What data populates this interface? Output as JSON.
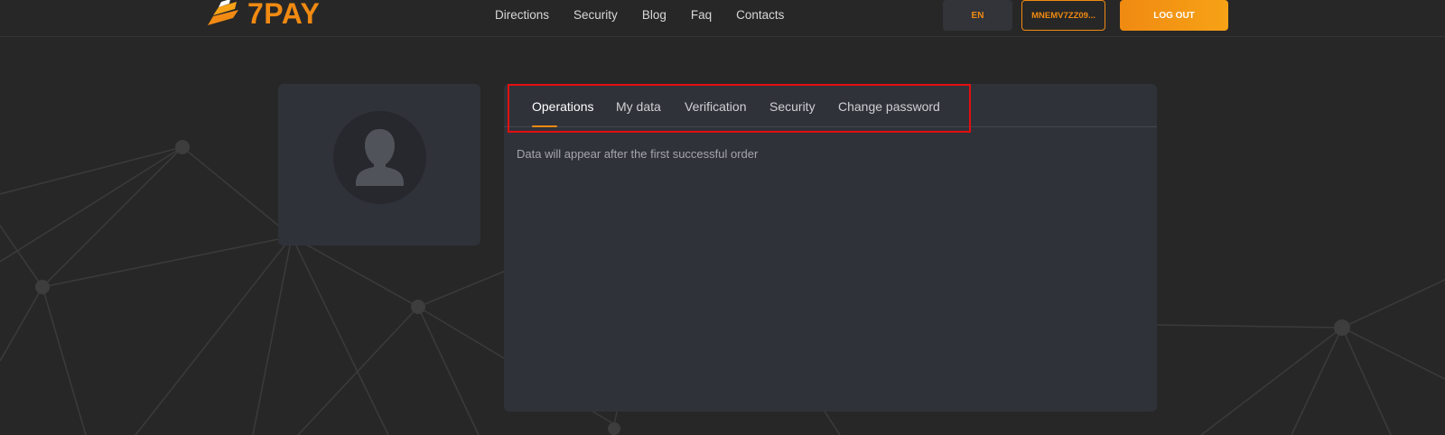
{
  "header": {
    "logo_text": "7PAY",
    "nav": [
      "Directions",
      "Security",
      "Blog",
      "Faq",
      "Contacts"
    ],
    "lang_label": "EN",
    "wallet_label": "MNEMV7ZZ09...",
    "logout_label": "LOG OUT"
  },
  "account": {
    "avatar_icon": "user-silhouette-icon",
    "tabs": [
      {
        "label": "Operations",
        "active": true
      },
      {
        "label": "My data",
        "active": false
      },
      {
        "label": "Verification",
        "active": false
      },
      {
        "label": "Security",
        "active": false
      },
      {
        "label": "Change password",
        "active": false
      }
    ],
    "empty_message": "Data will appear after the first successful order"
  },
  "colors": {
    "background": "#272727",
    "card": "#30323a",
    "accent": "#f08a12",
    "highlight": "#e30f0f"
  }
}
